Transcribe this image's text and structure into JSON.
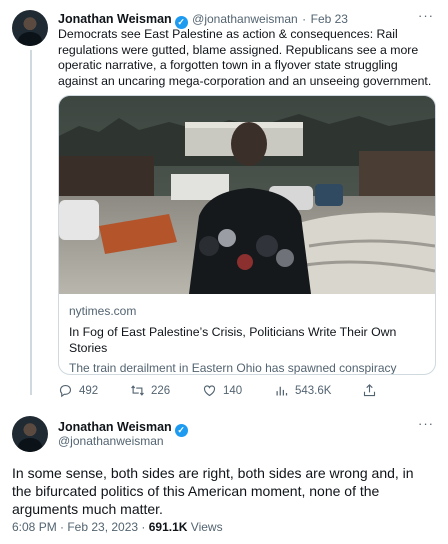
{
  "tweet1": {
    "name": "Jonathan Weisman",
    "handle": "@jonathanweisman",
    "separator": "·",
    "date": "Feb 23",
    "text": "Democrats see East Palestine as action & consequences: Rail regulations were gutted, blame assigned. Republicans see a more operatic narrative, a forgotten town in a flyover state struggling against an uncaring mega-corporation and an unseeing government.",
    "card": {
      "domain": "nytimes.com",
      "title": "In Fog of East Palestine’s Crisis, Politicians Write Their Own Stories",
      "description": "The train derailment in Eastern Ohio has spawned conspiracy theories and contradictory narratives, with politicians from both parties ..."
    },
    "actions": {
      "replies": "492",
      "retweets": "226",
      "likes": "140",
      "views": "543.6K"
    }
  },
  "tweet2": {
    "name": "Jonathan Weisman",
    "handle": "@jonathanweisman",
    "text": "In some sense, both sides are right, both sides are wrong and, in the bifurcated politics of this American moment, none of the arguments much matter.",
    "time": "6:08 PM · Feb 23, 2023 · ",
    "views_count": "691.1K",
    "views_label": " Views"
  },
  "icons": [
    "verified-icon",
    "more-icon",
    "reply-icon",
    "retweet-icon",
    "like-icon",
    "views-icon",
    "share-icon"
  ],
  "colors": {
    "verified": "#1d9bf0",
    "muted": "#536471",
    "text": "#0f1419",
    "border": "#cfd9de"
  }
}
